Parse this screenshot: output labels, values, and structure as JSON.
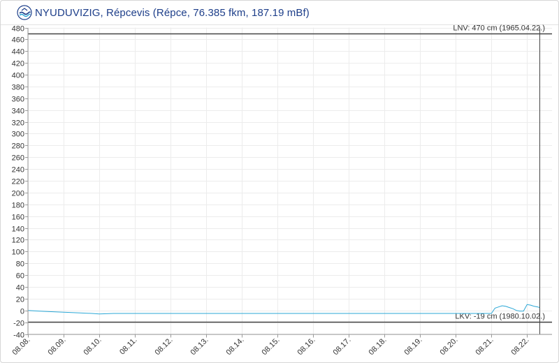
{
  "header": {
    "title": "NYUDUVIZIG, Répcevis (Répce, 76.385 fkm, 187.19 mBf)",
    "logo_icon": "nyuduvizig-logo-icon"
  },
  "chart_data": {
    "type": "line",
    "title": "NYUDUVIZIG, Répcevis (Répce, 76.385 fkm, 187.19 mBf)",
    "xlabel": "",
    "ylabel": "",
    "ylim": [
      -40,
      480
    ],
    "y_ticks": [
      480,
      460,
      440,
      420,
      400,
      380,
      360,
      340,
      320,
      300,
      280,
      260,
      240,
      220,
      200,
      180,
      160,
      140,
      120,
      100,
      80,
      60,
      40,
      20,
      0,
      -20,
      -40
    ],
    "x_ticks": [
      "08.08.",
      "08.09.",
      "08.10.",
      "08.11.",
      "08.12.",
      "08.13.",
      "08.14.",
      "08.15.",
      "08.16.",
      "08.17.",
      "08.18.",
      "08.19.",
      "08.20.",
      "08.21.",
      "08.22."
    ],
    "xlim": [
      0,
      14.7
    ],
    "grid": true,
    "line_color": "#2aa7d6",
    "reference_lines": [
      {
        "label": "LNV: 470 cm (1965.04.22.)",
        "value": 470,
        "color": "#444444"
      },
      {
        "label": "LKV: -19 cm (1980.10.02.)",
        "value": -19,
        "color": "#444444"
      }
    ],
    "current_marker": {
      "x": 14.35,
      "color": "#444444"
    },
    "series": [
      {
        "x": [
          0,
          0.3,
          0.6,
          1.0,
          1.4,
          1.8,
          2.0,
          2.4,
          3.0,
          4.0,
          5.0,
          6.0,
          7.0,
          8.0,
          9.0,
          10.0,
          11.0,
          12.0,
          12.5,
          13.0,
          13.1,
          13.2,
          13.3,
          13.4,
          13.5,
          13.6,
          13.7,
          13.8,
          13.9,
          14.0,
          14.1,
          14.2,
          14.3,
          14.35
        ],
        "values": [
          0,
          -1,
          -2,
          -3,
          -4,
          -5,
          -6,
          -5,
          -5,
          -5,
          -5,
          -5,
          -5,
          -5,
          -5,
          -5,
          -5,
          -5,
          -5,
          -5,
          4,
          6,
          8,
          7,
          5,
          3,
          0,
          -1,
          -1,
          10,
          9,
          7,
          6,
          5
        ]
      }
    ]
  }
}
